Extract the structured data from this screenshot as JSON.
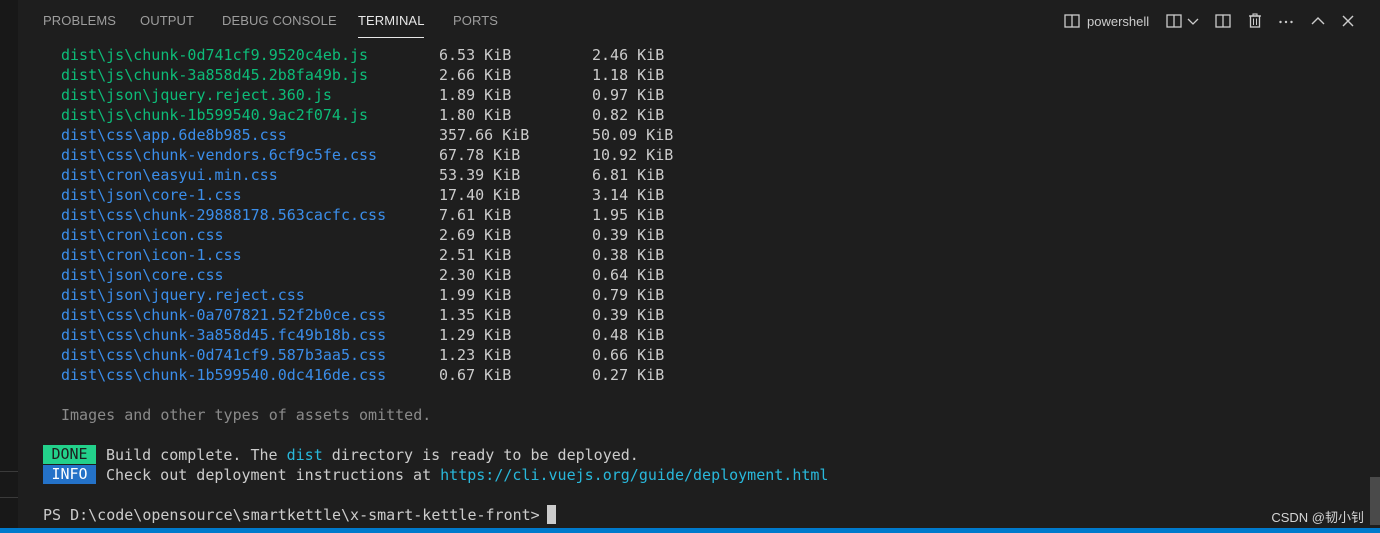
{
  "panel": {
    "tabs": [
      {
        "label": "PROBLEMS",
        "active": false
      },
      {
        "label": "OUTPUT",
        "active": false
      },
      {
        "label": "DEBUG CONSOLE",
        "active": false
      },
      {
        "label": "TERMINAL",
        "active": true
      },
      {
        "label": "PORTS",
        "active": false
      }
    ],
    "toolbar": {
      "shell_icon": "terminal-panel-icon",
      "shell_label": "powershell",
      "split_icon": "split-terminal-icon",
      "dropdown_icon": "chevron-down-icon",
      "layout_icon": "layout-icon",
      "trash_icon": "trash-icon",
      "more_icon": "more-icon",
      "maximize_icon": "chevron-up-icon",
      "close_icon": "close-icon"
    }
  },
  "terminal": {
    "asset_rows": [
      {
        "name": "dist\\js\\chunk-0d741cf9.9520c4eb.js",
        "size": "6.53 KiB",
        "gzip": "2.46 KiB",
        "color": "green"
      },
      {
        "name": "dist\\js\\chunk-3a858d45.2b8fa49b.js",
        "size": "2.66 KiB",
        "gzip": "1.18 KiB",
        "color": "green"
      },
      {
        "name": "dist\\json\\jquery.reject.360.js",
        "size": "1.89 KiB",
        "gzip": "0.97 KiB",
        "color": "green"
      },
      {
        "name": "dist\\js\\chunk-1b599540.9ac2f074.js",
        "size": "1.80 KiB",
        "gzip": "0.82 KiB",
        "color": "green"
      },
      {
        "name": "dist\\css\\app.6de8b985.css",
        "size": "357.66 KiB",
        "gzip": "50.09 KiB",
        "color": "blue"
      },
      {
        "name": "dist\\css\\chunk-vendors.6cf9c5fe.css",
        "size": "67.78 KiB",
        "gzip": "10.92 KiB",
        "color": "blue"
      },
      {
        "name": "dist\\cron\\easyui.min.css",
        "size": "53.39 KiB",
        "gzip": "6.81 KiB",
        "color": "blue"
      },
      {
        "name": "dist\\json\\core-1.css",
        "size": "17.40 KiB",
        "gzip": "3.14 KiB",
        "color": "blue"
      },
      {
        "name": "dist\\css\\chunk-29888178.563cacfc.css",
        "size": "7.61 KiB",
        "gzip": "1.95 KiB",
        "color": "blue"
      },
      {
        "name": "dist\\cron\\icon.css",
        "size": "2.69 KiB",
        "gzip": "0.39 KiB",
        "color": "blue"
      },
      {
        "name": "dist\\cron\\icon-1.css",
        "size": "2.51 KiB",
        "gzip": "0.38 KiB",
        "color": "blue"
      },
      {
        "name": "dist\\json\\core.css",
        "size": "2.30 KiB",
        "gzip": "0.64 KiB",
        "color": "blue"
      },
      {
        "name": "dist\\json\\jquery.reject.css",
        "size": "1.99 KiB",
        "gzip": "0.79 KiB",
        "color": "blue"
      },
      {
        "name": "dist\\css\\chunk-0a707821.52f2b0ce.css",
        "size": "1.35 KiB",
        "gzip": "0.39 KiB",
        "color": "blue"
      },
      {
        "name": "dist\\css\\chunk-3a858d45.fc49b18b.css",
        "size": "1.29 KiB",
        "gzip": "0.48 KiB",
        "color": "blue"
      },
      {
        "name": "dist\\css\\chunk-0d741cf9.587b3aa5.css",
        "size": "1.23 KiB",
        "gzip": "0.66 KiB",
        "color": "blue"
      },
      {
        "name": "dist\\css\\chunk-1b599540.0dc416de.css",
        "size": "0.67 KiB",
        "gzip": "0.27 KiB",
        "color": "blue"
      }
    ],
    "omitted_note": "Images and other types of assets omitted.",
    "done_badge": "DONE",
    "done_text_before": "Build complete. The ",
    "done_text_highlight": "dist",
    "done_text_after": " directory is ready to be deployed.",
    "info_badge": "INFO",
    "info_text": "Check out deployment instructions at ",
    "info_link": "https://cli.vuejs.org/guide/deployment.html",
    "prompt": "PS D:\\code\\opensource\\smartkettle\\x-smart-kettle-front> "
  },
  "watermark": "CSDN @韧小钊",
  "colors": {
    "background": "#1e1e1e",
    "green": "#23d18b",
    "blue": "#3b8eea",
    "cyan": "#29b8db",
    "done_badge": "#23d18b",
    "info_badge": "#2472c8",
    "status_bar": "#007acc"
  }
}
